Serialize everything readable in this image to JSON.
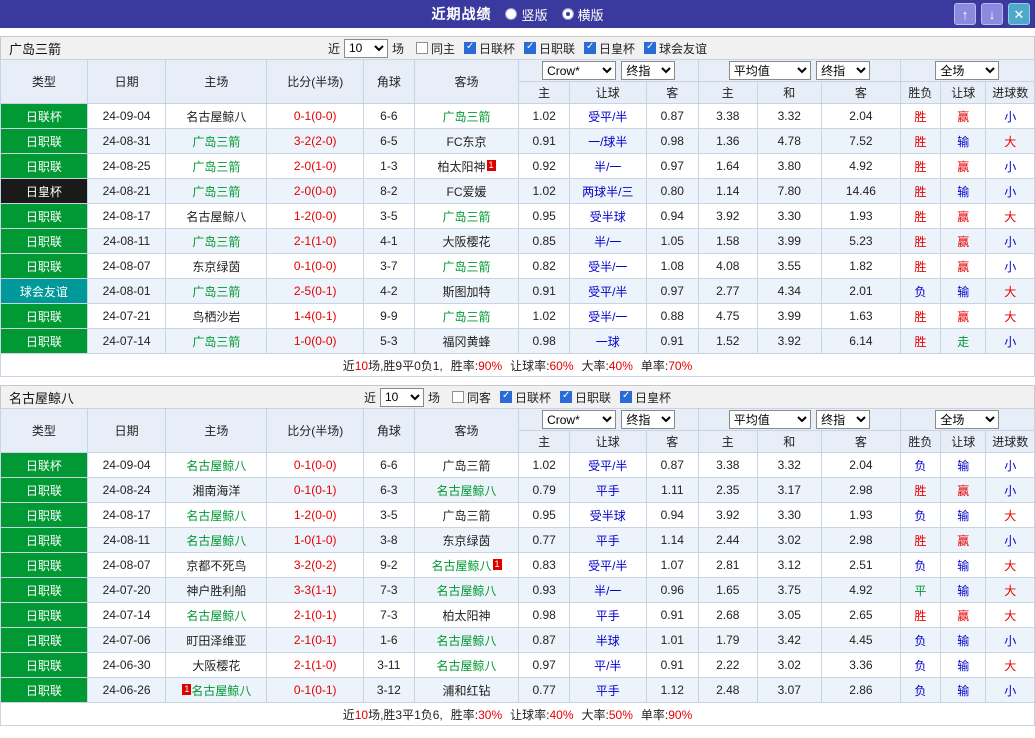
{
  "titlebar": {
    "title": "近期战绩",
    "radios": [
      {
        "label": "竖版",
        "selected": false
      },
      {
        "label": "横版",
        "selected": true
      }
    ],
    "buttons": {
      "up": "↑",
      "down": "↓",
      "close": "✕"
    }
  },
  "controls": {
    "near": "近",
    "count": "10",
    "matches": "场"
  },
  "header": {
    "cols": {
      "type": "类型",
      "date": "日期",
      "home": "主场",
      "score": "比分(半场)",
      "corner": "角球",
      "away": "客场",
      "odds_home": "主",
      "odds_handicap": "让球",
      "odds_away": "客",
      "avg_home": "主",
      "avg_draw": "和",
      "avg_away": "客",
      "result": "胜负",
      "handicap_result": "让球",
      "goals": "进球数"
    },
    "selects": {
      "bookmaker": "Crow*",
      "final_a": "终指",
      "average": "平均值",
      "final_b": "终指",
      "full": "全场"
    }
  },
  "colors": {
    "accent": "#3a3a9e",
    "green": "#009933",
    "red": "#e60000",
    "blue": "#0000cc",
    "teal": "#009999",
    "dark": "#1a1a1a"
  },
  "tables": [
    {
      "team": "广岛三箭",
      "filters": [
        {
          "label": "同主",
          "checked": false
        },
        {
          "label": "日联杯",
          "checked": true
        },
        {
          "label": "日职联",
          "checked": true
        },
        {
          "label": "日皇杯",
          "checked": true
        },
        {
          "label": "球会友谊",
          "checked": true
        }
      ],
      "rows": [
        {
          "type": "日联杯",
          "date": "24-09-04",
          "home": {
            "name": "名古屋鲸八",
            "subject": false
          },
          "score": "0-1(0-0)",
          "corner": "6-6",
          "away": {
            "name": "广岛三箭",
            "subject": true
          },
          "odds": [
            "1.02",
            "受平/半",
            "0.87"
          ],
          "avg": [
            "3.38",
            "3.32",
            "2.04"
          ],
          "result": "胜",
          "handicap_result": "赢",
          "goals": "小"
        },
        {
          "type": "日职联",
          "date": "24-08-31",
          "home": {
            "name": "广岛三箭",
            "subject": true
          },
          "score": "3-2(2-0)",
          "corner": "6-5",
          "away": {
            "name": "FC东京",
            "subject": false
          },
          "odds": [
            "0.91",
            "一/球半",
            "0.98"
          ],
          "avg": [
            "1.36",
            "4.78",
            "7.52"
          ],
          "result": "胜",
          "handicap_result": "输",
          "goals": "大"
        },
        {
          "type": "日职联",
          "date": "24-08-25",
          "home": {
            "name": "广岛三箭",
            "subject": true
          },
          "score": "2-0(1-0)",
          "corner": "1-3",
          "away": {
            "name": "柏太阳神",
            "subject": false,
            "card": "1",
            "card_pos": "after"
          },
          "odds": [
            "0.92",
            "半/一",
            "0.97"
          ],
          "avg": [
            "1.64",
            "3.80",
            "4.92"
          ],
          "result": "胜",
          "handicap_result": "赢",
          "goals": "小"
        },
        {
          "type": "日皇杯",
          "date": "24-08-21",
          "home": {
            "name": "广岛三箭",
            "subject": true
          },
          "score": "2-0(0-0)",
          "corner": "8-2",
          "away": {
            "name": "FC爱媛",
            "subject": false
          },
          "odds": [
            "1.02",
            "两球半/三",
            "0.80"
          ],
          "avg": [
            "1.14",
            "7.80",
            "14.46"
          ],
          "result": "胜",
          "handicap_result": "输",
          "goals": "小"
        },
        {
          "type": "日职联",
          "date": "24-08-17",
          "home": {
            "name": "名古屋鲸八",
            "subject": false
          },
          "score": "1-2(0-0)",
          "corner": "3-5",
          "away": {
            "name": "广岛三箭",
            "subject": true
          },
          "odds": [
            "0.95",
            "受半球",
            "0.94"
          ],
          "avg": [
            "3.92",
            "3.30",
            "1.93"
          ],
          "result": "胜",
          "handicap_result": "赢",
          "goals": "大"
        },
        {
          "type": "日职联",
          "date": "24-08-11",
          "home": {
            "name": "广岛三箭",
            "subject": true
          },
          "score": "2-1(1-0)",
          "corner": "4-1",
          "away": {
            "name": "大阪樱花",
            "subject": false
          },
          "odds": [
            "0.85",
            "半/一",
            "1.05"
          ],
          "avg": [
            "1.58",
            "3.99",
            "5.23"
          ],
          "result": "胜",
          "handicap_result": "赢",
          "goals": "小"
        },
        {
          "type": "日职联",
          "date": "24-08-07",
          "home": {
            "name": "东京绿茵",
            "subject": false
          },
          "score": "0-1(0-0)",
          "corner": "3-7",
          "away": {
            "name": "广岛三箭",
            "subject": true
          },
          "odds": [
            "0.82",
            "受半/一",
            "1.08"
          ],
          "avg": [
            "4.08",
            "3.55",
            "1.82"
          ],
          "result": "胜",
          "handicap_result": "赢",
          "goals": "小"
        },
        {
          "type": "球会友谊",
          "date": "24-08-01",
          "home": {
            "name": "广岛三箭",
            "subject": true
          },
          "score": "2-5(0-1)",
          "corner": "4-2",
          "away": {
            "name": "斯图加特",
            "subject": false
          },
          "odds": [
            "0.91",
            "受平/半",
            "0.97"
          ],
          "avg": [
            "2.77",
            "4.34",
            "2.01"
          ],
          "result": "负",
          "handicap_result": "输",
          "goals": "大"
        },
        {
          "type": "日职联",
          "date": "24-07-21",
          "home": {
            "name": "鸟栖沙岩",
            "subject": false
          },
          "score": "1-4(0-1)",
          "corner": "9-9",
          "away": {
            "name": "广岛三箭",
            "subject": true
          },
          "odds": [
            "1.02",
            "受半/一",
            "0.88"
          ],
          "avg": [
            "4.75",
            "3.99",
            "1.63"
          ],
          "result": "胜",
          "handicap_result": "赢",
          "goals": "大"
        },
        {
          "type": "日职联",
          "date": "24-07-14",
          "home": {
            "name": "广岛三箭",
            "subject": true
          },
          "score": "1-0(0-0)",
          "corner": "5-3",
          "away": {
            "name": "福冈黄蜂",
            "subject": false
          },
          "odds": [
            "0.98",
            "一球",
            "0.91"
          ],
          "avg": [
            "1.52",
            "3.92",
            "6.14"
          ],
          "result": "胜",
          "handicap_result": "走",
          "goals": "小"
        }
      ],
      "summary": {
        "lead": [
          {
            "t": "近"
          },
          {
            "t": "10",
            "red": true
          },
          {
            "t": "场,胜9平0负1,"
          }
        ],
        "stats": [
          {
            "label": "胜率:",
            "value": "90%"
          },
          {
            "label": "让球率:",
            "value": "60%"
          },
          {
            "label": "大率:",
            "value": "40%"
          },
          {
            "label": "单率:",
            "value": "70%"
          }
        ]
      }
    },
    {
      "team": "名古屋鲸八",
      "filters": [
        {
          "label": "同客",
          "checked": false
        },
        {
          "label": "日联杯",
          "checked": true
        },
        {
          "label": "日职联",
          "checked": true
        },
        {
          "label": "日皇杯",
          "checked": true
        }
      ],
      "rows": [
        {
          "type": "日联杯",
          "date": "24-09-04",
          "home": {
            "name": "名古屋鲸八",
            "subject": true
          },
          "score": "0-1(0-0)",
          "corner": "6-6",
          "away": {
            "name": "广岛三箭",
            "subject": false
          },
          "odds": [
            "1.02",
            "受平/半",
            "0.87"
          ],
          "avg": [
            "3.38",
            "3.32",
            "2.04"
          ],
          "result": "负",
          "handicap_result": "输",
          "goals": "小"
        },
        {
          "type": "日职联",
          "date": "24-08-24",
          "home": {
            "name": "湘南海洋",
            "subject": false
          },
          "score": "0-1(0-1)",
          "corner": "6-3",
          "away": {
            "name": "名古屋鲸八",
            "subject": true
          },
          "odds": [
            "0.79",
            "平手",
            "1.11"
          ],
          "avg": [
            "2.35",
            "3.17",
            "2.98"
          ],
          "result": "胜",
          "handicap_result": "赢",
          "goals": "小"
        },
        {
          "type": "日职联",
          "date": "24-08-17",
          "home": {
            "name": "名古屋鲸八",
            "subject": true
          },
          "score": "1-2(0-0)",
          "corner": "3-5",
          "away": {
            "name": "广岛三箭",
            "subject": false
          },
          "odds": [
            "0.95",
            "受半球",
            "0.94"
          ],
          "avg": [
            "3.92",
            "3.30",
            "1.93"
          ],
          "result": "负",
          "handicap_result": "输",
          "goals": "大"
        },
        {
          "type": "日职联",
          "date": "24-08-11",
          "home": {
            "name": "名古屋鲸八",
            "subject": true
          },
          "score": "1-0(1-0)",
          "corner": "3-8",
          "away": {
            "name": "东京绿茵",
            "subject": false
          },
          "odds": [
            "0.77",
            "平手",
            "1.14"
          ],
          "avg": [
            "2.44",
            "3.02",
            "2.98"
          ],
          "result": "胜",
          "handicap_result": "赢",
          "goals": "小"
        },
        {
          "type": "日职联",
          "date": "24-08-07",
          "home": {
            "name": "京都不死鸟",
            "subject": false
          },
          "score": "3-2(0-2)",
          "corner": "9-2",
          "away": {
            "name": "名古屋鲸八",
            "subject": true,
            "card": "1",
            "card_pos": "after"
          },
          "odds": [
            "0.83",
            "受平/半",
            "1.07"
          ],
          "avg": [
            "2.81",
            "3.12",
            "2.51"
          ],
          "result": "负",
          "handicap_result": "输",
          "goals": "大"
        },
        {
          "type": "日职联",
          "date": "24-07-20",
          "home": {
            "name": "神户胜利船",
            "subject": false
          },
          "score": "3-3(1-1)",
          "corner": "7-3",
          "away": {
            "name": "名古屋鲸八",
            "subject": true
          },
          "odds": [
            "0.93",
            "半/一",
            "0.96"
          ],
          "avg": [
            "1.65",
            "3.75",
            "4.92"
          ],
          "result": "平",
          "handicap_result": "输",
          "goals": "大"
        },
        {
          "type": "日职联",
          "date": "24-07-14",
          "home": {
            "name": "名古屋鲸八",
            "subject": true
          },
          "score": "2-1(0-1)",
          "corner": "7-3",
          "away": {
            "name": "柏太阳神",
            "subject": false
          },
          "odds": [
            "0.98",
            "平手",
            "0.91"
          ],
          "avg": [
            "2.68",
            "3.05",
            "2.65"
          ],
          "result": "胜",
          "handicap_result": "赢",
          "goals": "大"
        },
        {
          "type": "日职联",
          "date": "24-07-06",
          "home": {
            "name": "町田泽维亚",
            "subject": false
          },
          "score": "2-1(0-1)",
          "corner": "1-6",
          "away": {
            "name": "名古屋鲸八",
            "subject": true
          },
          "odds": [
            "0.87",
            "半球",
            "1.01"
          ],
          "avg": [
            "1.79",
            "3.42",
            "4.45"
          ],
          "result": "负",
          "handicap_result": "输",
          "goals": "小"
        },
        {
          "type": "日职联",
          "date": "24-06-30",
          "home": {
            "name": "大阪樱花",
            "subject": false
          },
          "score": "2-1(1-0)",
          "corner": "3-11",
          "away": {
            "name": "名古屋鲸八",
            "subject": true
          },
          "odds": [
            "0.97",
            "平/半",
            "0.91"
          ],
          "avg": [
            "2.22",
            "3.02",
            "3.36"
          ],
          "result": "负",
          "handicap_result": "输",
          "goals": "大"
        },
        {
          "type": "日职联",
          "date": "24-06-26",
          "home": {
            "name": "名古屋鲸八",
            "subject": true,
            "card": "1",
            "card_pos": "before"
          },
          "score": "0-1(0-1)",
          "corner": "3-12",
          "away": {
            "name": "浦和红钻",
            "subject": false
          },
          "odds": [
            "0.77",
            "平手",
            "1.12"
          ],
          "avg": [
            "2.48",
            "3.07",
            "2.86"
          ],
          "result": "负",
          "handicap_result": "输",
          "goals": "小"
        }
      ],
      "summary": {
        "lead": [
          {
            "t": "近"
          },
          {
            "t": "10",
            "red": true
          },
          {
            "t": "场,胜3平1负6,"
          }
        ],
        "stats": [
          {
            "label": "胜率:",
            "value": "30%"
          },
          {
            "label": "让球率:",
            "value": "40%"
          },
          {
            "label": "大率:",
            "value": "50%"
          },
          {
            "label": "单率:",
            "value": "90%"
          }
        ]
      }
    }
  ]
}
